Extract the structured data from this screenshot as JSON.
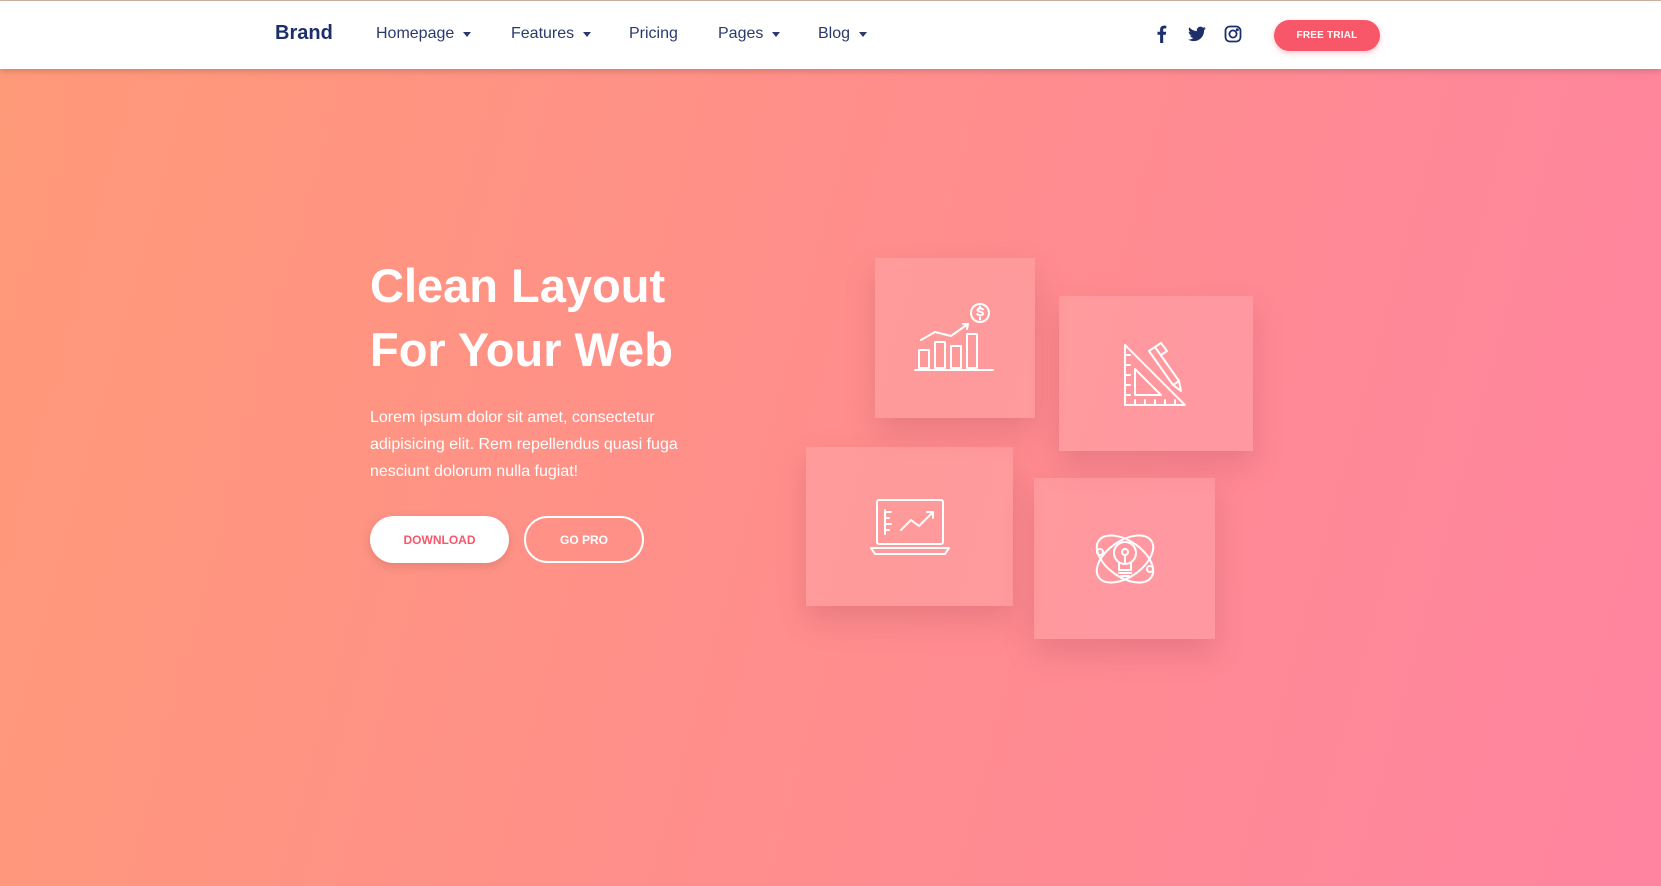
{
  "navbar": {
    "brand": "Brand",
    "items": [
      {
        "label": "Homepage",
        "dropdown": true
      },
      {
        "label": "Features",
        "dropdown": true
      },
      {
        "label": "Pricing",
        "dropdown": false
      },
      {
        "label": "Pages",
        "dropdown": true
      },
      {
        "label": "Blog",
        "dropdown": true
      }
    ],
    "social_icons": [
      "facebook-icon",
      "twitter-icon",
      "instagram-icon"
    ],
    "cta_label": "FREE TRIAL"
  },
  "hero": {
    "title_line1": "Clean Layout",
    "title_line2": "For Your Web",
    "description": "Lorem ipsum dolor sit amet, consectetur adipisicing elit. Rem repellendus quasi fuga nesciunt dolorum nulla fugiat!",
    "primary_button": "DOWNLOAD",
    "secondary_button": "GO PRO"
  },
  "feature_cards": [
    {
      "icon": "growth-chart-dollar-icon"
    },
    {
      "icon": "ruler-pencil-icon"
    },
    {
      "icon": "laptop-analytics-icon"
    },
    {
      "icon": "idea-bulb-atom-icon"
    }
  ],
  "colors": {
    "brand_text": "#1d2f6b",
    "accent": "#f8576a",
    "gradient_start": "#ff9a78",
    "gradient_end": "#ff84a0"
  }
}
